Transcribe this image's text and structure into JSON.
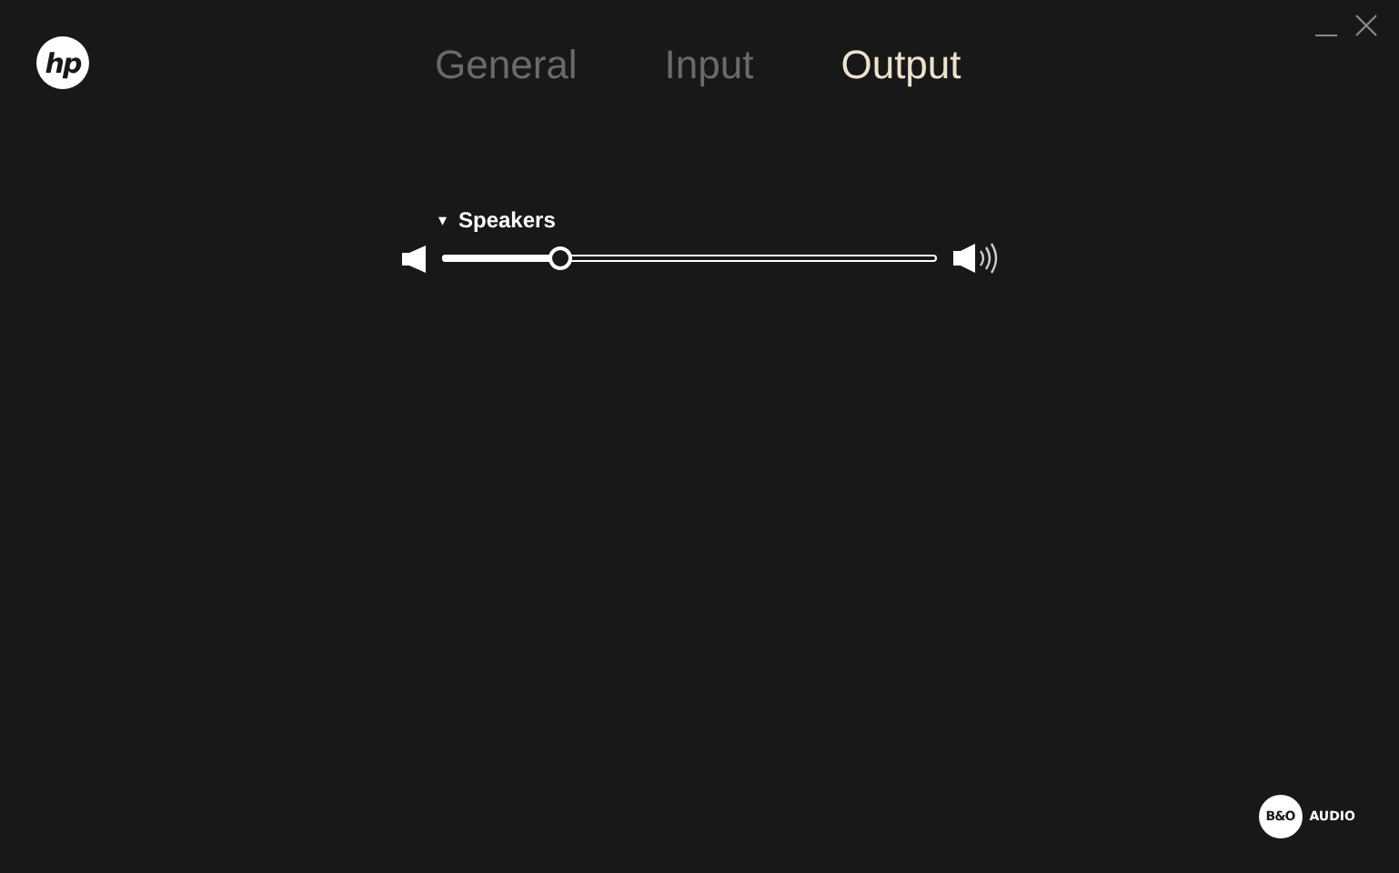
{
  "logo": {
    "text": "hp"
  },
  "tabs": [
    {
      "label": "General",
      "selected": false
    },
    {
      "label": "Input",
      "selected": false
    },
    {
      "label": "Output",
      "selected": true
    }
  ],
  "device": {
    "caret": "▾",
    "name": "Speakers",
    "level": 0.24
  },
  "brand": {
    "mark": "B&O",
    "label": "AUDIO"
  }
}
